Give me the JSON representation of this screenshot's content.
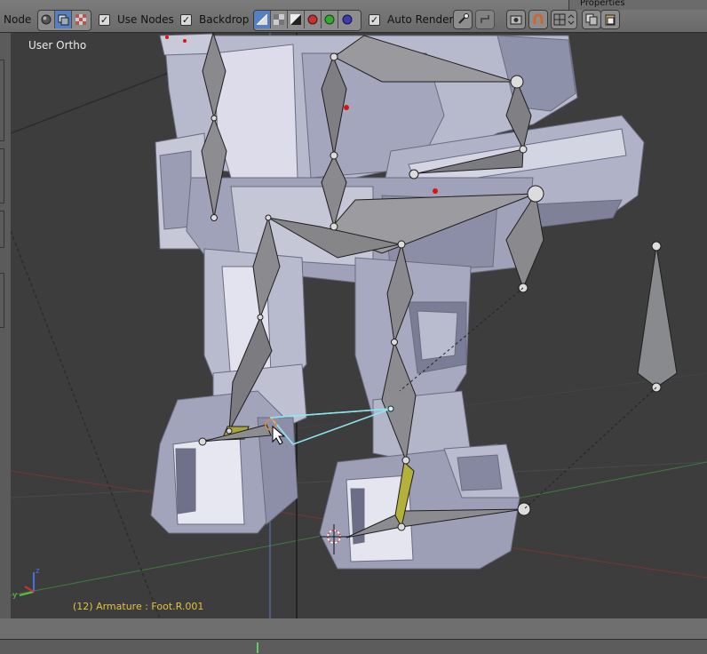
{
  "header": {
    "editor_type": "Node",
    "use_nodes_label": "Use Nodes",
    "backdrop_label": "Backdrop",
    "auto_render_label": "Auto Render",
    "properties_tab": "Properties"
  },
  "viewport": {
    "view_label": "User Ortho",
    "status_text": "(12) Armature : Foot.R.001"
  },
  "colors": {
    "header": "#737373",
    "viewport_bg": "#3d3d3d",
    "selected_bone": "#8ee6f0",
    "active_bone": "#b4b03c",
    "status_text": "#e3c341"
  }
}
